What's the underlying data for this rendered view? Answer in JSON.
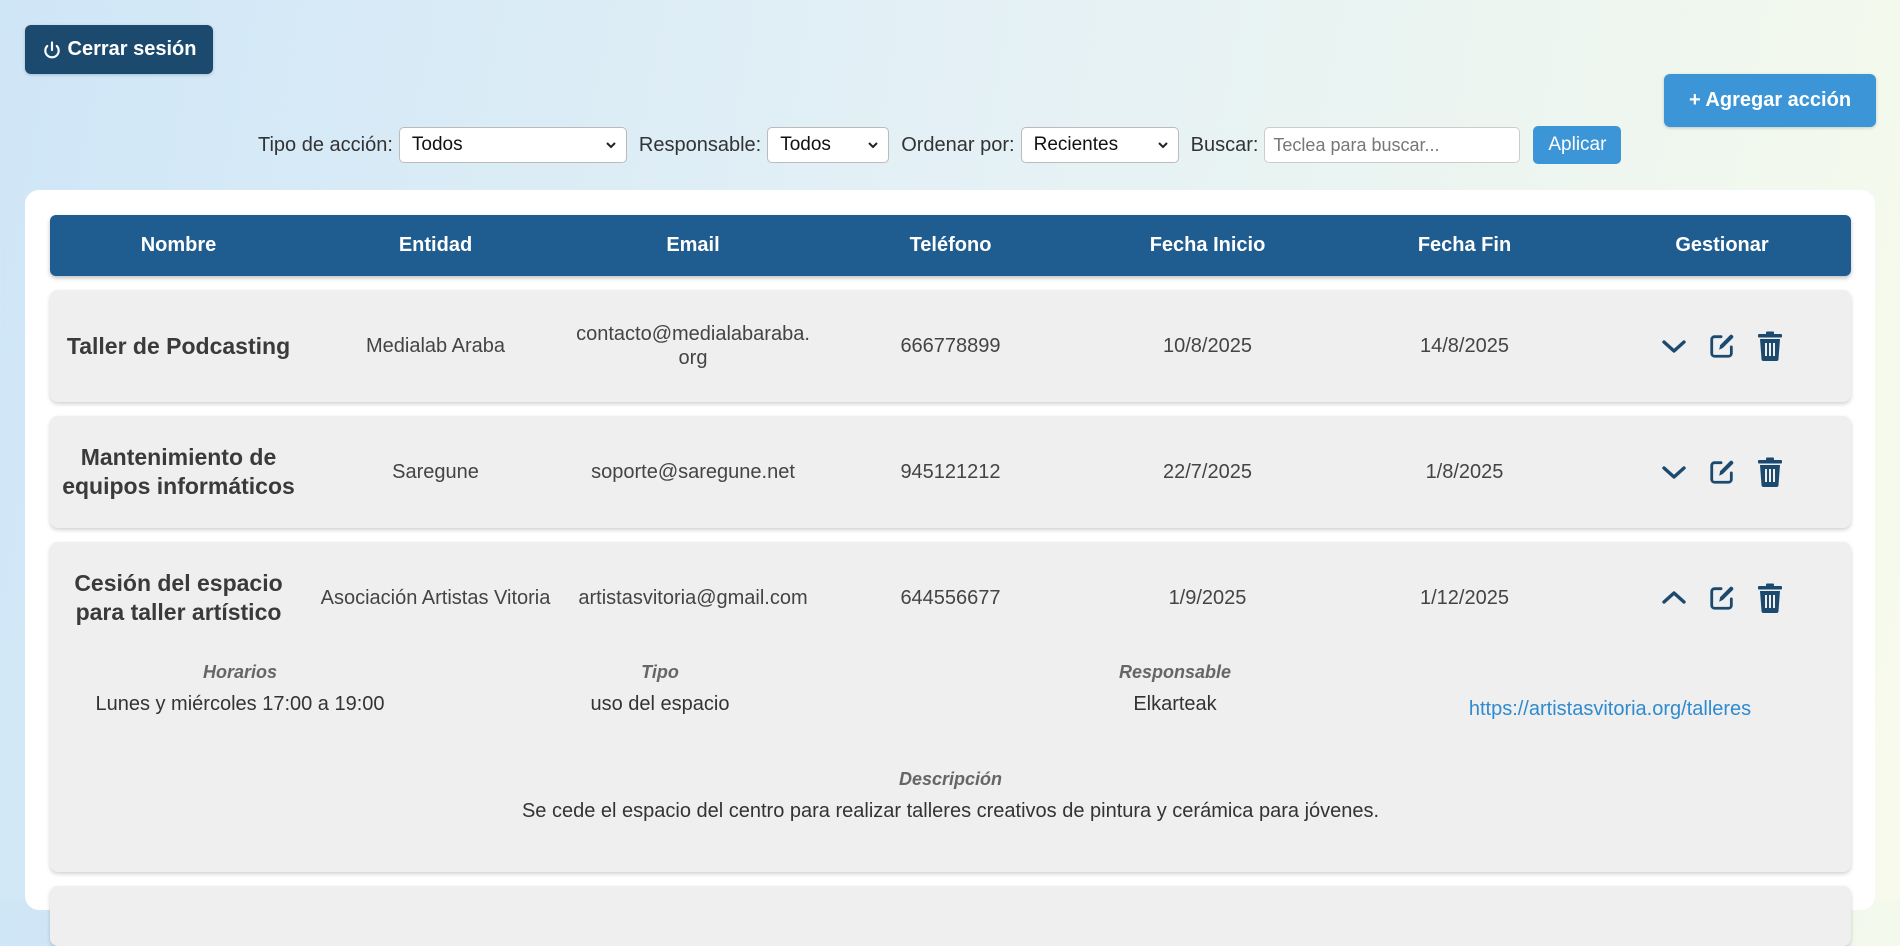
{
  "header": {
    "logout_label": "Cerrar sesión",
    "add_label": "+ Agregar acción"
  },
  "filters": {
    "tipo_label": "Tipo de acción:",
    "tipo_value": "Todos",
    "responsable_label": "Responsable:",
    "responsable_value": "Todos",
    "orden_label": "Ordenar por:",
    "orden_value": "Recientes",
    "buscar_label": "Buscar:",
    "buscar_placeholder": "Teclea para buscar...",
    "apply_label": "Aplicar"
  },
  "table": {
    "headers": [
      "Nombre",
      "Entidad",
      "Email",
      "Teléfono",
      "Fecha Inicio",
      "Fecha Fin",
      "Gestionar"
    ],
    "rows": [
      {
        "name": "Taller de Podcasting",
        "entity": "Medialab Araba",
        "email_line1": "contacto@medialabaraba.",
        "email_line2": "org",
        "phone": "666778899",
        "start": "10/8/2025",
        "end": "14/8/2025",
        "expanded": false
      },
      {
        "name_line1": "Mantenimiento de",
        "name_line2": "equipos informáticos",
        "entity": "Saregune",
        "email": "soporte@saregune.net",
        "phone": "945121212",
        "start": "22/7/2025",
        "end": "1/8/2025",
        "expanded": false
      },
      {
        "name_line1": "Cesión del espacio",
        "name_line2": "para taller artístico",
        "entity": "Asociación Artistas Vitoria",
        "email": "artistasvitoria@gmail.com",
        "phone": "644556677",
        "start": "1/9/2025",
        "end": "1/12/2025",
        "expanded": true,
        "details": {
          "horarios_label": "Horarios",
          "horarios": "Lunes y miércoles 17:00 a 19:00",
          "tipo_label": "Tipo",
          "tipo": "uso del espacio",
          "responsable_label": "Responsable",
          "responsable": "Elkarteak",
          "link": "https://artistasvitoria.org/talleres",
          "descripcion_label": "Descripción",
          "descripcion": "Se cede el espacio del centro para realizar talleres creativos de pintura y cerámica para jóvenes."
        }
      }
    ]
  },
  "colors": {
    "header_bg": "#1f5c8f",
    "logout_bg": "#1c4a6e",
    "accent": "#3b95d6",
    "icon": "#1c4a6e"
  }
}
